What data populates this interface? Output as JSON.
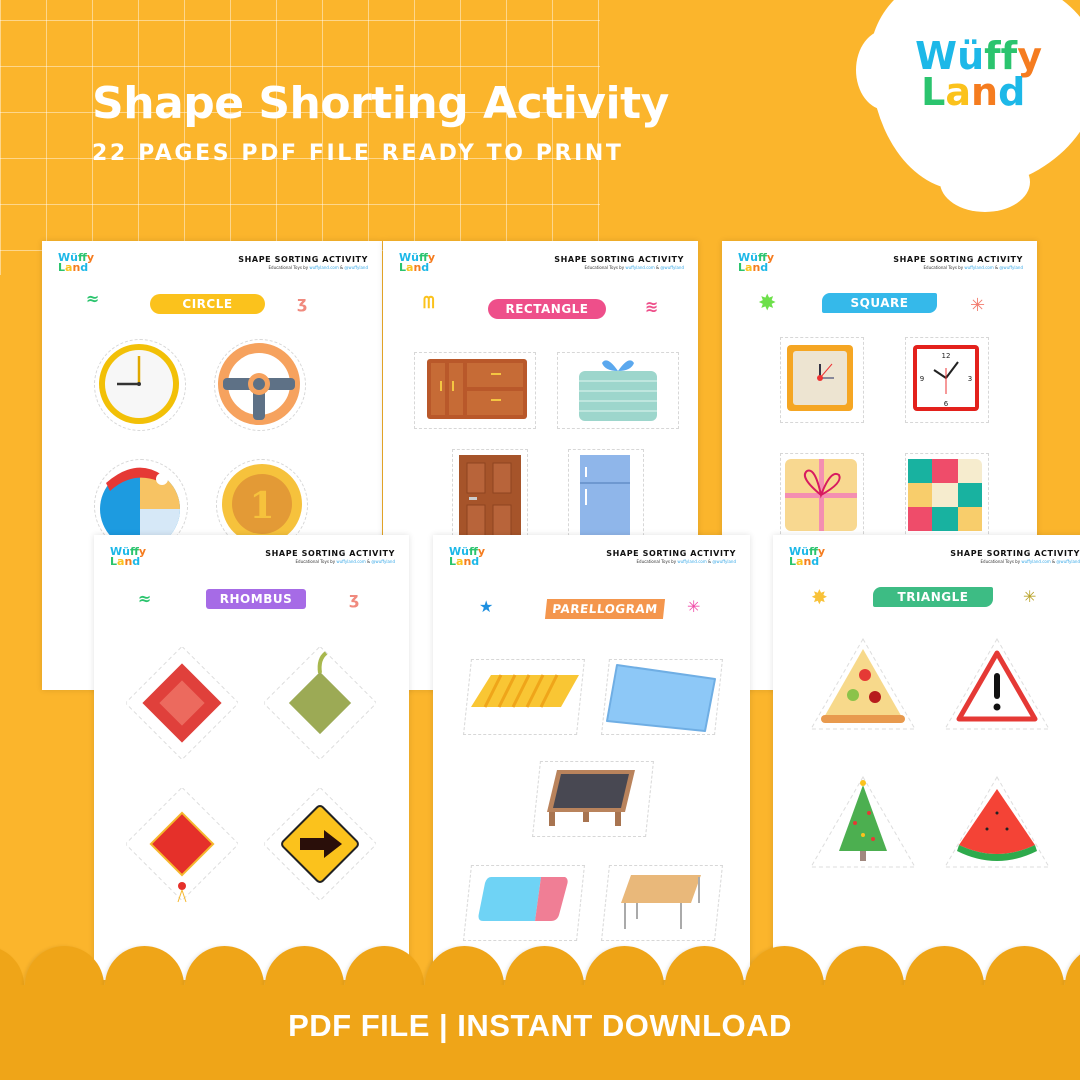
{
  "header": {
    "title": "Shape Shorting Activity",
    "subtitle": "22 PAGES PDF FILE READY TO PRINT"
  },
  "brand": {
    "line1": [
      "W",
      "ü",
      "f",
      "f",
      "y"
    ],
    "line2": [
      "L",
      "a",
      "n",
      "d"
    ],
    "colors1": [
      "#1DB8E8",
      "#1DB8E8",
      "#2BC46E",
      "#2BC46E",
      "#F57C1F"
    ],
    "colors2": [
      "#2BC46E",
      "#FBC21C",
      "#F57C1F",
      "#1DB8E8"
    ]
  },
  "page_header": {
    "title": "SHAPE SORTING ACTIVITY",
    "credit_prefix": "Educational Toys by ",
    "credit_site": "wuffyland.com",
    "credit_amp": " & ",
    "credit_handle": "@wuffyland"
  },
  "pages": [
    {
      "label": "CIRCLE",
      "color": "#FBC21C",
      "items": [
        "clock-icon",
        "steering-wheel-icon",
        "beach-ball-icon",
        "coin-icon"
      ]
    },
    {
      "label": "RECTANGLE",
      "color": "#EE4F8A",
      "items": [
        "cabinet-icon",
        "gift-box-icon",
        "door-icon",
        "fridge-icon"
      ]
    },
    {
      "label": "SQUARE",
      "color": "#35B9EA",
      "items": [
        "square-clock-icon",
        "wall-clock-icon",
        "gift-icon",
        "puzzle-icon"
      ]
    },
    {
      "label": "RHOMBUS",
      "color": "#A66BE6",
      "items": [
        "gem-icon",
        "ketupat-icon",
        "lantern-icon",
        "road-sign-icon"
      ]
    },
    {
      "label": "PARELLOGRAM",
      "color": "#F4964D",
      "items": [
        "mat-icon",
        "pillow-icon",
        "chalkboard-icon",
        "eraser-icon",
        "table-icon"
      ]
    },
    {
      "label": "TRIANGLE",
      "color": "#3DBC84",
      "items": [
        "pizza-icon",
        "warning-sign-icon",
        "christmas-tree-icon",
        "watermelon-icon"
      ]
    }
  ],
  "footer": {
    "text": "PDF FILE | INSTANT DOWNLOAD"
  }
}
